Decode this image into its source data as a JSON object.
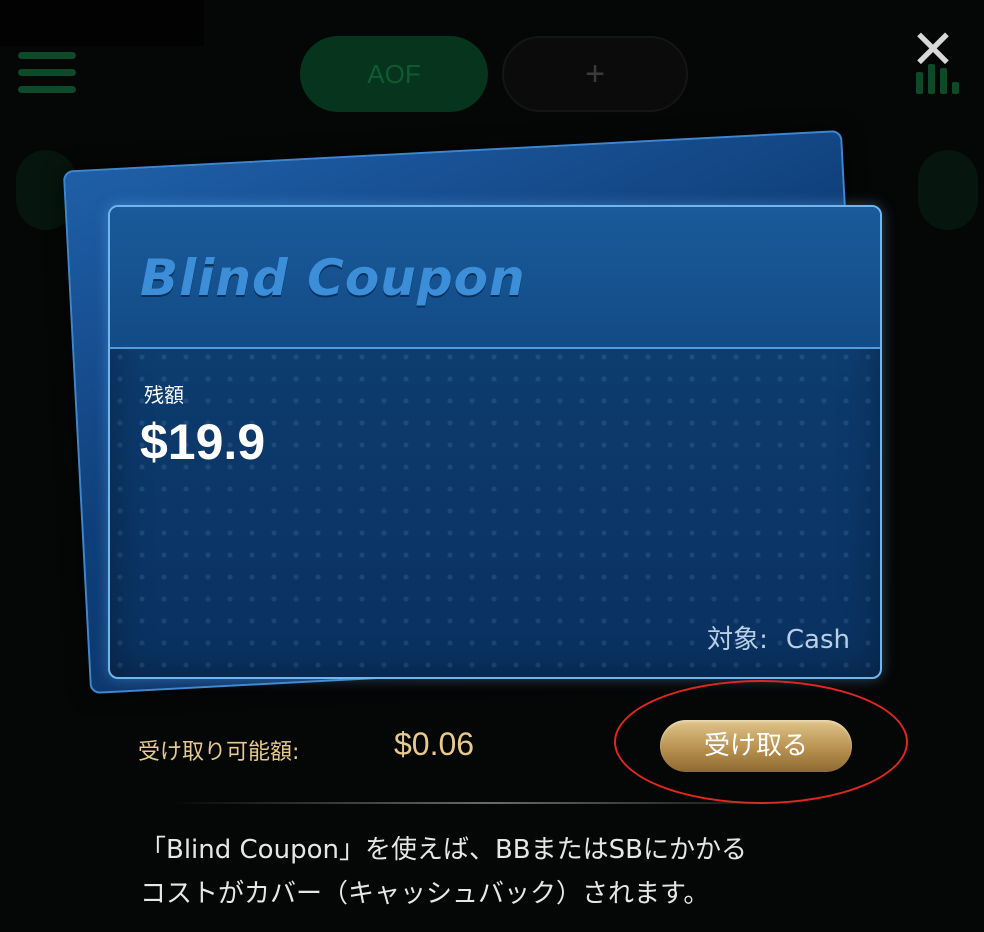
{
  "background": {
    "tabs": [
      {
        "label": "AOF",
        "active": true
      },
      {
        "label": "+",
        "active": false
      }
    ]
  },
  "close_icon": "close-icon",
  "coupon": {
    "title": "Blind Coupon",
    "balance_label": "残額",
    "balance_value": "$19.9",
    "target_label": "対象:",
    "target_value": "Cash"
  },
  "claim": {
    "label": "受け取り可能額:",
    "amount": "$0.06",
    "button_label": "受け取る"
  },
  "description": {
    "line1": "「Blind Coupon」を使えば、BBまたはSBにかかる",
    "line2": "コストがカバー（キャッシュバック）されます。"
  },
  "colors": {
    "card_blue": "#0c3a6c",
    "gold_text": "#e8c98c",
    "highlight_ring": "#e0271f"
  }
}
